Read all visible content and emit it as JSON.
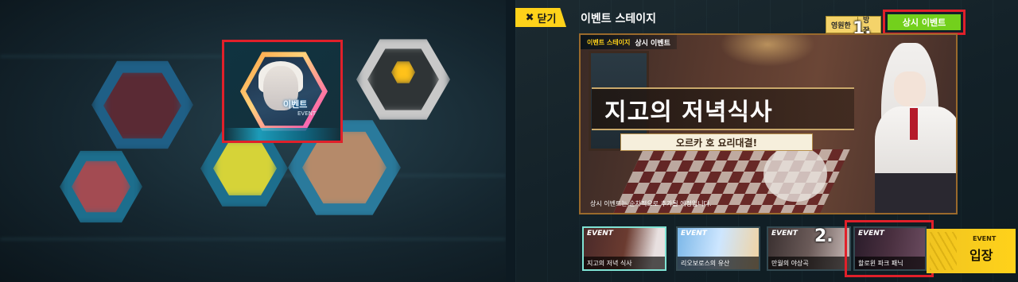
{
  "left_panel": {
    "event_tile": {
      "label": "이벤트",
      "sub": "EVENT"
    }
  },
  "right_panel": {
    "close_label": "닫기",
    "title": "이벤트 스테이지",
    "tabs": [
      "영원한",
      "방장"
    ],
    "active_tab": "상시 이벤트",
    "markers": [
      "1.",
      "2."
    ],
    "banner": {
      "tag_kind": "이벤트 스테이지",
      "tag_name": "상시 이벤트",
      "title": "지고의 저녁식사",
      "subtitle": "오르카 호 요리대결!",
      "footnote": "상시 이벤트는 순차적으로 추가될 예정입니다."
    },
    "thumbnails": [
      {
        "tag": "EVENT",
        "caption": "지고의 저녁 식사"
      },
      {
        "tag": "EVENT",
        "caption": "리오보로스의 유산"
      },
      {
        "tag": "EVENT",
        "caption": "만월의 야상곡"
      },
      {
        "tag": "EVENT",
        "caption": "할로윈 파크 패닉"
      }
    ],
    "enter": {
      "small": "EVENT",
      "label": "입장"
    }
  },
  "colors": {
    "accent_yellow": "#ffd21a",
    "highlight_red": "#e0202a",
    "active_green": "#73d01c"
  }
}
